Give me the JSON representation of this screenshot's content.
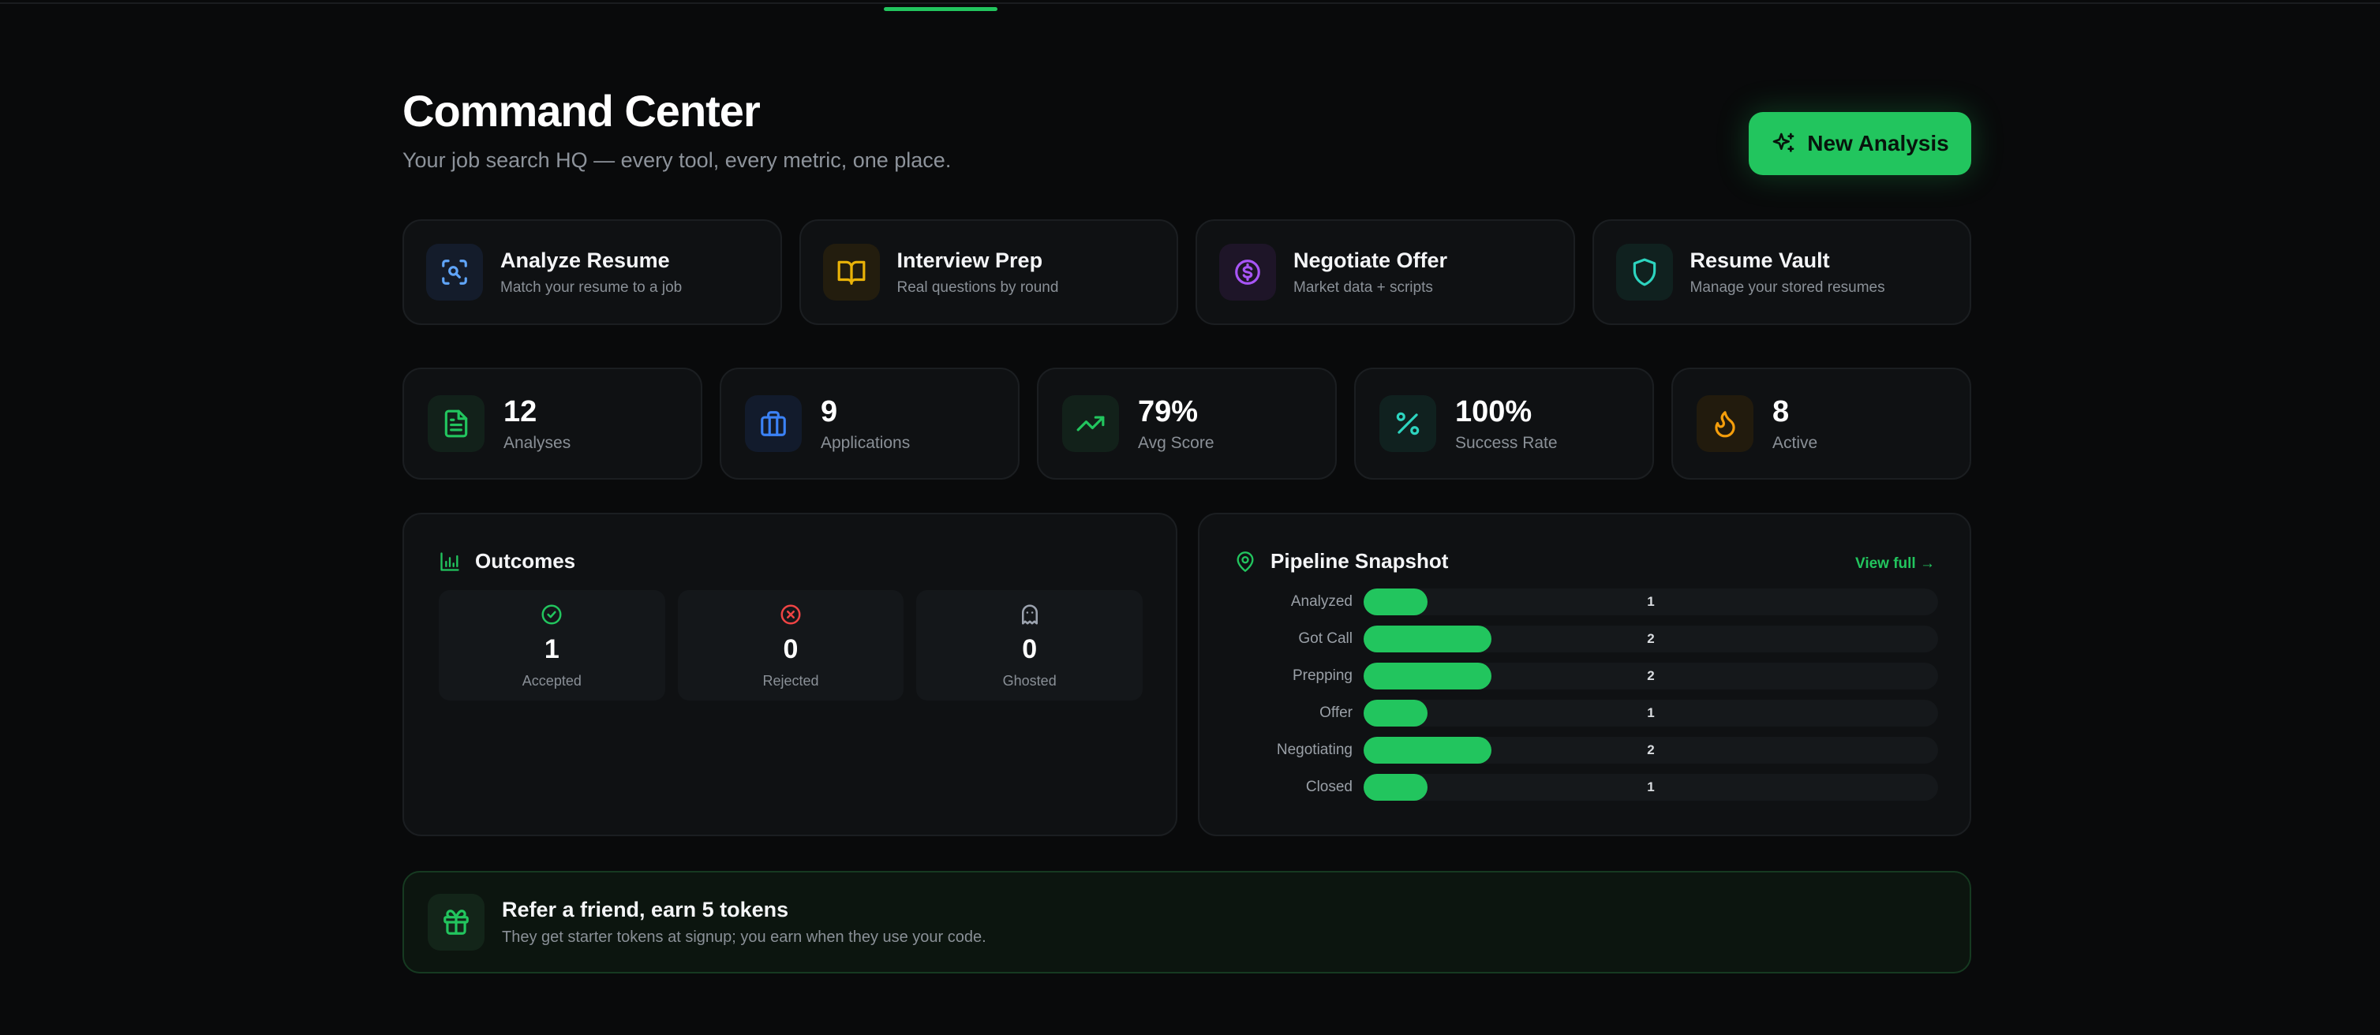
{
  "header": {
    "title": "Command Center",
    "subtitle": "Your job search HQ — every tool, every metric, one place.",
    "new_analysis_label": "New Analysis"
  },
  "quick_actions": [
    {
      "title": "Analyze Resume",
      "desc": "Match your resume to a job",
      "icon": "scan-search-icon",
      "color": "#60a5fa"
    },
    {
      "title": "Interview Prep",
      "desc": "Real questions by round",
      "icon": "book-open-icon",
      "color": "#eab308"
    },
    {
      "title": "Negotiate Offer",
      "desc": "Market data + scripts",
      "icon": "dollar-circle-icon",
      "color": "#a855f7"
    },
    {
      "title": "Resume Vault",
      "desc": "Manage your stored resumes",
      "icon": "shield-icon",
      "color": "#2dd4bf"
    }
  ],
  "stats": [
    {
      "value": "12",
      "label": "Analyses",
      "icon": "file-text-icon",
      "color": "#22c55e"
    },
    {
      "value": "9",
      "label": "Applications",
      "icon": "briefcase-icon",
      "color": "#3b82f6"
    },
    {
      "value": "79%",
      "label": "Avg Score",
      "icon": "trending-up-icon",
      "color": "#22c55e"
    },
    {
      "value": "100%",
      "label": "Success Rate",
      "icon": "percent-icon",
      "color": "#2dd4bf"
    },
    {
      "value": "8",
      "label": "Active",
      "icon": "flame-icon",
      "color": "#f59e0b"
    }
  ],
  "outcomes": {
    "title": "Outcomes",
    "items": [
      {
        "value": "1",
        "label": "Accepted",
        "icon": "check-circle-icon",
        "color": "#22c55e"
      },
      {
        "value": "0",
        "label": "Rejected",
        "icon": "x-circle-icon",
        "color": "#ef4444"
      },
      {
        "value": "0",
        "label": "Ghosted",
        "icon": "ghost-icon",
        "color": "#9ca3af"
      }
    ]
  },
  "pipeline": {
    "title": "Pipeline Snapshot",
    "view_full_label": "View full →",
    "max": 9,
    "stages": [
      {
        "label": "Analyzed",
        "count": 1
      },
      {
        "label": "Got Call",
        "count": 2
      },
      {
        "label": "Prepping",
        "count": 2
      },
      {
        "label": "Offer",
        "count": 1
      },
      {
        "label": "Negotiating",
        "count": 2
      },
      {
        "label": "Closed",
        "count": 1
      }
    ]
  },
  "referral": {
    "title": "Refer a friend, earn 5 tokens",
    "desc": "They get starter tokens at signup; you earn when they use your code."
  },
  "colors": {
    "accent": "#22c55e",
    "background": "#090a0b",
    "card": "#0f1113"
  }
}
